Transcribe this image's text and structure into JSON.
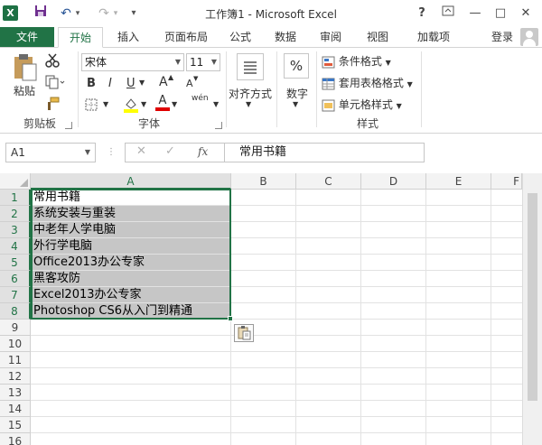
{
  "window": {
    "title": "工作簿1 - Microsoft Excel",
    "app_icon": "X",
    "controls": {
      "help": "?",
      "minimize": "—",
      "restore": "□",
      "close": "✕"
    }
  },
  "quick_access": {
    "undo": "↶",
    "redo": "↷",
    "customize": "▾"
  },
  "tabs": [
    {
      "label": "文件"
    },
    {
      "label": "开始"
    },
    {
      "label": "插入"
    },
    {
      "label": "页面布局"
    },
    {
      "label": "公式"
    },
    {
      "label": "数据"
    },
    {
      "label": "审阅"
    },
    {
      "label": "视图"
    },
    {
      "label": "加载项"
    }
  ],
  "active_tab": "开始",
  "login_label": "登录",
  "ribbon": {
    "clipboard": {
      "paste_label": "粘贴",
      "group_label": "剪贴板"
    },
    "font": {
      "name": "宋体",
      "size": "11",
      "bold": "B",
      "italic": "I",
      "underline": "U",
      "grow": "A",
      "shrink": "A",
      "font_color_glyph": "A",
      "phonetic": "wén",
      "group_label": "字体"
    },
    "alignment": {
      "label": "对齐方式"
    },
    "number": {
      "label": "数字",
      "symbol": "%"
    },
    "styles": {
      "conditional": "条件格式",
      "table_format": "套用表格格式",
      "cell_styles": "单元格样式",
      "group_label": "样式"
    }
  },
  "formula_bar": {
    "name_box": "A1",
    "cancel": "✕",
    "enter": "✓",
    "fx": "fx",
    "value": "常用书籍"
  },
  "grid": {
    "columns": [
      "A",
      "B",
      "C",
      "D",
      "E",
      "F"
    ],
    "rows": [
      "1",
      "2",
      "3",
      "4",
      "5",
      "6",
      "7",
      "8",
      "9",
      "10",
      "11",
      "12",
      "13",
      "14",
      "15",
      "16"
    ],
    "cells_a": [
      "常用书籍",
      "系统安装与重装",
      "中老年人学电脑",
      "外行学电脑",
      "Office2013办公专家",
      "黑客攻防",
      "Excel2013办公专家",
      "Photoshop CS6从入门到精通"
    ],
    "selected_range": "A1:A8",
    "colors": {
      "accent": "#217346",
      "selection_fill": "#c6c6c6"
    }
  }
}
